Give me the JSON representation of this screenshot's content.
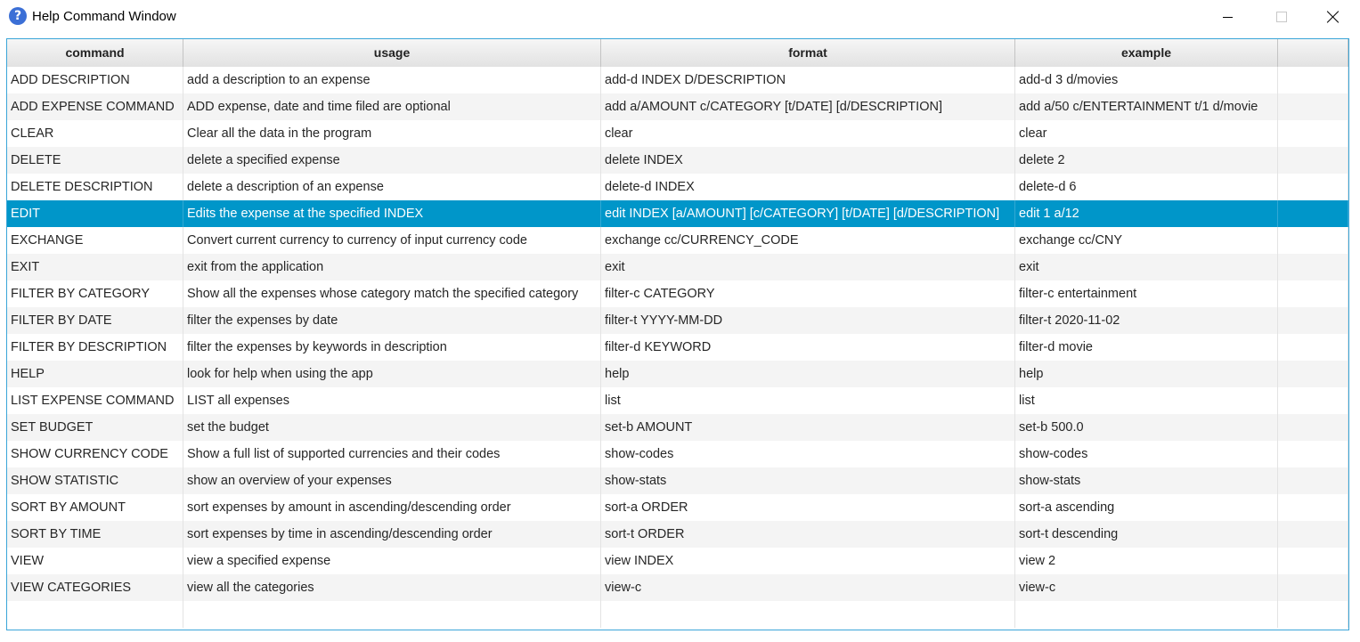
{
  "window": {
    "title": "Help Command Window",
    "icon": "help-question-icon",
    "accent": "#0096c9"
  },
  "table": {
    "columns": [
      "command",
      "usage",
      "format",
      "example"
    ],
    "selected_index": 5,
    "rows": [
      {
        "command": "ADD DESCRIPTION",
        "usage": "add a description to an expense",
        "format": "add-d INDEX D/DESCRIPTION",
        "example": "add-d 3 d/movies"
      },
      {
        "command": "ADD EXPENSE COMMAND",
        "usage": "ADD expense, date and time filed are optional",
        "format": "add a/AMOUNT c/CATEGORY [t/DATE] [d/DESCRIPTION]",
        "example": "add a/50 c/ENTERTAINMENT t/1 d/movie"
      },
      {
        "command": "CLEAR",
        "usage": "Clear all the data in the program",
        "format": "clear",
        "example": "clear"
      },
      {
        "command": "DELETE",
        "usage": "delete a specified expense",
        "format": "delete INDEX",
        "example": "delete 2"
      },
      {
        "command": "DELETE DESCRIPTION",
        "usage": "delete a description of an expense",
        "format": "delete-d INDEX",
        "example": "delete-d 6"
      },
      {
        "command": "EDIT",
        "usage": "Edits the expense at the specified INDEX",
        "format": "edit INDEX [a/AMOUNT] [c/CATEGORY] [t/DATE] [d/DESCRIPTION]",
        "example": "edit 1 a/12"
      },
      {
        "command": "EXCHANGE",
        "usage": "Convert current currency to currency of input currency code",
        "format": "exchange cc/CURRENCY_CODE",
        "example": "exchange cc/CNY"
      },
      {
        "command": "EXIT",
        "usage": "exit from the application",
        "format": "exit",
        "example": "exit"
      },
      {
        "command": "FILTER BY CATEGORY",
        "usage": "Show all the expenses whose category match the specified category",
        "format": "filter-c CATEGORY",
        "example": "filter-c entertainment"
      },
      {
        "command": "FILTER BY DATE",
        "usage": "filter the expenses by date",
        "format": "filter-t YYYY-MM-DD",
        "example": "filter-t 2020-11-02"
      },
      {
        "command": "FILTER BY DESCRIPTION",
        "usage": "filter the expenses by keywords in description",
        "format": "filter-d KEYWORD",
        "example": "filter-d movie"
      },
      {
        "command": "HELP",
        "usage": "look for help when using the app",
        "format": "help",
        "example": "help"
      },
      {
        "command": "LIST EXPENSE COMMAND",
        "usage": "LIST all expenses",
        "format": "list",
        "example": "list"
      },
      {
        "command": "SET BUDGET",
        "usage": "set the budget",
        "format": "set-b AMOUNT",
        "example": "set-b 500.0"
      },
      {
        "command": "SHOW CURRENCY CODE",
        "usage": "Show a full list of supported currencies and their codes",
        "format": "show-codes",
        "example": "show-codes"
      },
      {
        "command": "SHOW STATISTIC",
        "usage": "show an overview of your expenses",
        "format": "show-stats",
        "example": "show-stats"
      },
      {
        "command": "SORT BY AMOUNT",
        "usage": "sort expenses by amount in ascending/descending order",
        "format": "sort-a ORDER",
        "example": "sort-a ascending"
      },
      {
        "command": "SORT BY TIME",
        "usage": "sort expenses by time in ascending/descending order",
        "format": "sort-t ORDER",
        "example": "sort-t descending"
      },
      {
        "command": "VIEW",
        "usage": "view a specified expense",
        "format": "view INDEX",
        "example": "view 2"
      },
      {
        "command": "VIEW CATEGORIES",
        "usage": "view all the categories",
        "format": "view-c",
        "example": "view-c"
      }
    ]
  }
}
